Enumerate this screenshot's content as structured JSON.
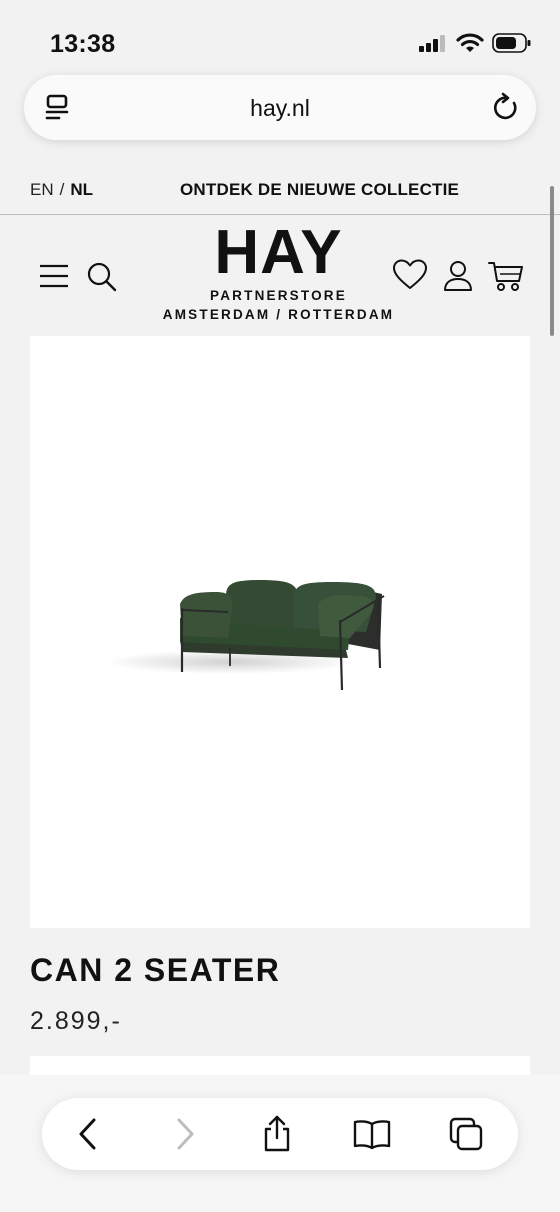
{
  "status": {
    "time": "13:38"
  },
  "browser": {
    "url": "hay.nl"
  },
  "topbar": {
    "lang_en": "EN",
    "lang_sep": "/",
    "lang_nl": "NL",
    "promo": "ONTDEK DE NIEUWE COLLECTIE"
  },
  "brand": {
    "logo": "HAY",
    "line1": "PARTNERSTORE",
    "line2": "AMSTERDAM / ROTTERDAM"
  },
  "header_icons": [
    "menu-icon",
    "search-icon",
    "heart-icon",
    "user-icon",
    "cart-icon"
  ],
  "product": {
    "title": "CAN 2 SEATER",
    "price": "2.899,-"
  },
  "toolbar_icons": [
    "back-icon",
    "forward-icon",
    "share-icon",
    "bookmarks-icon",
    "tabs-icon"
  ]
}
